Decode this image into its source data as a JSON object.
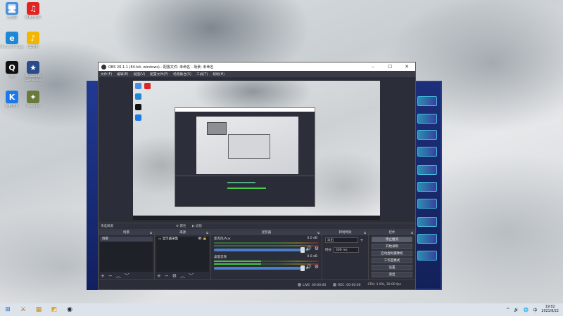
{
  "desktop": {
    "icons": [
      {
        "label": "此电脑",
        "glyph": "🖥",
        "bg": "#4a90d9"
      },
      {
        "label": "网易云音乐",
        "glyph": "♫",
        "bg": "#e02424"
      },
      {
        "label": "Microsoft Edge",
        "glyph": "e",
        "bg": "#1e88d6"
      },
      {
        "label": "QQ音乐",
        "glyph": "♪",
        "bg": "#f2b600"
      },
      {
        "label": "QQ",
        "glyph": "Q",
        "bg": "#111111"
      },
      {
        "label": "Alienware Command",
        "glyph": "★",
        "bg": "#2a4a8a"
      },
      {
        "label": "酷狗音乐",
        "glyph": "K",
        "bg": "#1e78e8"
      },
      {
        "label": "Genshin",
        "glyph": "✦",
        "bg": "#6a7a3a"
      }
    ]
  },
  "obs": {
    "title": "OBS 26.1.1 (64-bit, windows) - 配置文件: 未命名 - 场景: 未命名",
    "menu": [
      "文件(F)",
      "编辑(E)",
      "视图(V)",
      "配置文件(P)",
      "场景集合(S)",
      "工具(T)",
      "帮助(H)"
    ],
    "status_scene": "未选择源",
    "status_buttons": [
      "⚙ 属性",
      "◐ 滤镜"
    ],
    "docks": {
      "scenes": {
        "title": "场景",
        "items": [
          "场景"
        ]
      },
      "sources": {
        "title": "来源",
        "items": [
          "显示器采集"
        ]
      },
      "mixer": {
        "title": "混音器",
        "tracks": [
          {
            "name": "麦克风/Aux",
            "db": "0.0 dB",
            "level": 0.0
          },
          {
            "name": "桌面音频",
            "db": "0.0 dB",
            "level": 0.45
          }
        ]
      },
      "transitions": {
        "title": "转场特效",
        "type": "淡出",
        "duration_label": "时长",
        "duration": "300 ms"
      },
      "controls": {
        "title": "控件",
        "buttons": [
          "停止推流",
          "开始录制",
          "启动虚拟摄像机",
          "工作室模式",
          "设置",
          "退出"
        ]
      }
    },
    "statusbar": {
      "live_label": "LIVE:",
      "live_time": "00:00:00",
      "rec_label": "REC:",
      "rec_time": "00:00:00",
      "cpu": "CPU: 1.9%, 30.00 fps"
    }
  },
  "taskbar": {
    "apps": [
      "⊞",
      "⚔",
      "▦",
      "◩",
      "◉"
    ],
    "tray": [
      "^",
      "🔊",
      "🌐",
      "中"
    ],
    "time": "19:02",
    "date": "2021/8/22"
  }
}
